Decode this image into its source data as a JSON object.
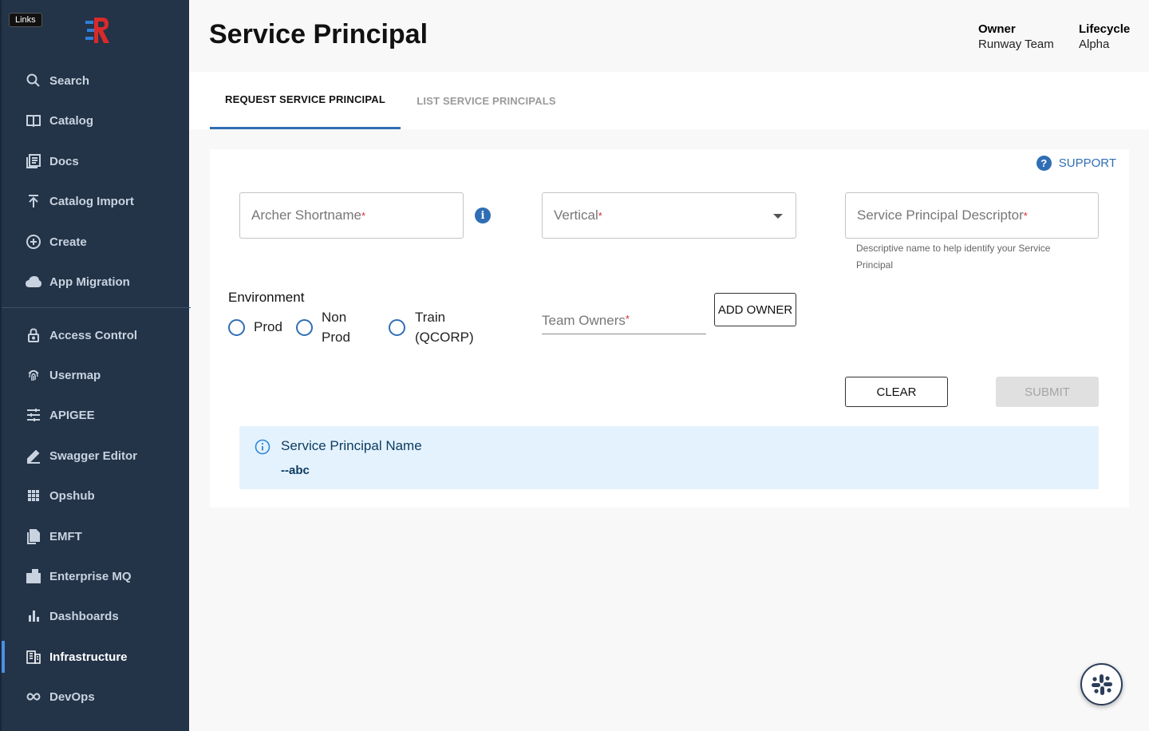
{
  "sidebar": {
    "links_badge": "Links",
    "items": [
      {
        "label": "Search",
        "icon": "search-icon"
      },
      {
        "label": "Catalog",
        "icon": "book-icon"
      },
      {
        "label": "Docs",
        "icon": "docs-icon"
      },
      {
        "label": "Catalog Import",
        "icon": "upload-icon"
      },
      {
        "label": "Create",
        "icon": "plus-circle-icon"
      },
      {
        "label": "App Migration",
        "icon": "cloud-icon"
      },
      {
        "label": "Access Control",
        "icon": "lock-icon"
      },
      {
        "label": "Usermap",
        "icon": "fingerprint-icon"
      },
      {
        "label": "APIGEE",
        "icon": "tune-icon"
      },
      {
        "label": "Swagger Editor",
        "icon": "pencil-icon"
      },
      {
        "label": "Opshub",
        "icon": "grid-icon"
      },
      {
        "label": "EMFT",
        "icon": "files-icon"
      },
      {
        "label": "Enterprise MQ",
        "icon": "queue-icon"
      },
      {
        "label": "Dashboards",
        "icon": "bar-chart-icon"
      },
      {
        "label": "Infrastructure",
        "icon": "building-icon"
      },
      {
        "label": "DevOps",
        "icon": "infinity-icon"
      }
    ]
  },
  "header": {
    "title": "Service Principal",
    "owner_label": "Owner",
    "owner_value": "Runway Team",
    "lifecycle_label": "Lifecycle",
    "lifecycle_value": "Alpha"
  },
  "tabs": {
    "request": "REQUEST SERVICE PRINCIPAL",
    "list": "LIST SERVICE PRINCIPALS"
  },
  "form": {
    "support": "SUPPORT",
    "archer_placeholder": "Archer Shortname",
    "vertical_placeholder": "Vertical",
    "descriptor_placeholder": "Service Principal Descriptor",
    "required_mark": "*",
    "descriptor_helper": "Descriptive name to help identify your Service Principal",
    "environment_label": "Environment",
    "env_options": {
      "prod": "Prod",
      "nonprod_line1": "Non",
      "nonprod_line2": "Prod",
      "train_line1": "Train",
      "train_line2": "(QCORP)"
    },
    "team_owners_placeholder": "Team Owners",
    "add_owner": "ADD OWNER",
    "clear": "CLEAR",
    "submit": "SUBMIT"
  },
  "alert": {
    "title": "Service Principal Name",
    "value": "--abc"
  },
  "colors": {
    "sidebar_bg": "#233348",
    "accent": "#2f6eb5",
    "alert_bg": "#e4f2fd",
    "required": "#d32f2f"
  }
}
